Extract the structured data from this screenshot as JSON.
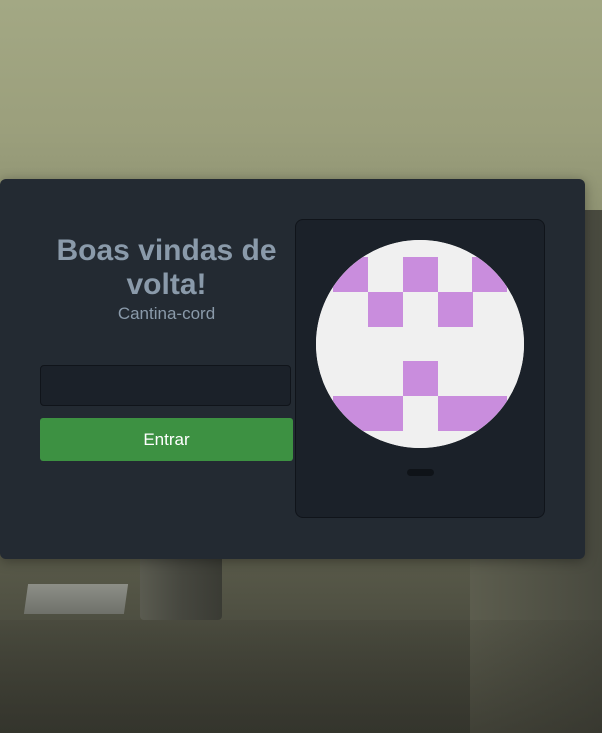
{
  "login": {
    "title": "Boas vindas de volta!",
    "subtitle": "Cantina-cord",
    "input_value": "",
    "input_placeholder": "",
    "submit_label": "Entrar"
  },
  "avatar": {
    "icon": "identicon",
    "pattern_color": "#c98ddd",
    "background_color": "#f0f0f0"
  },
  "colors": {
    "card_bg": "#232a32",
    "button_bg": "#3d9142",
    "title_color": "#8a9aaa"
  }
}
